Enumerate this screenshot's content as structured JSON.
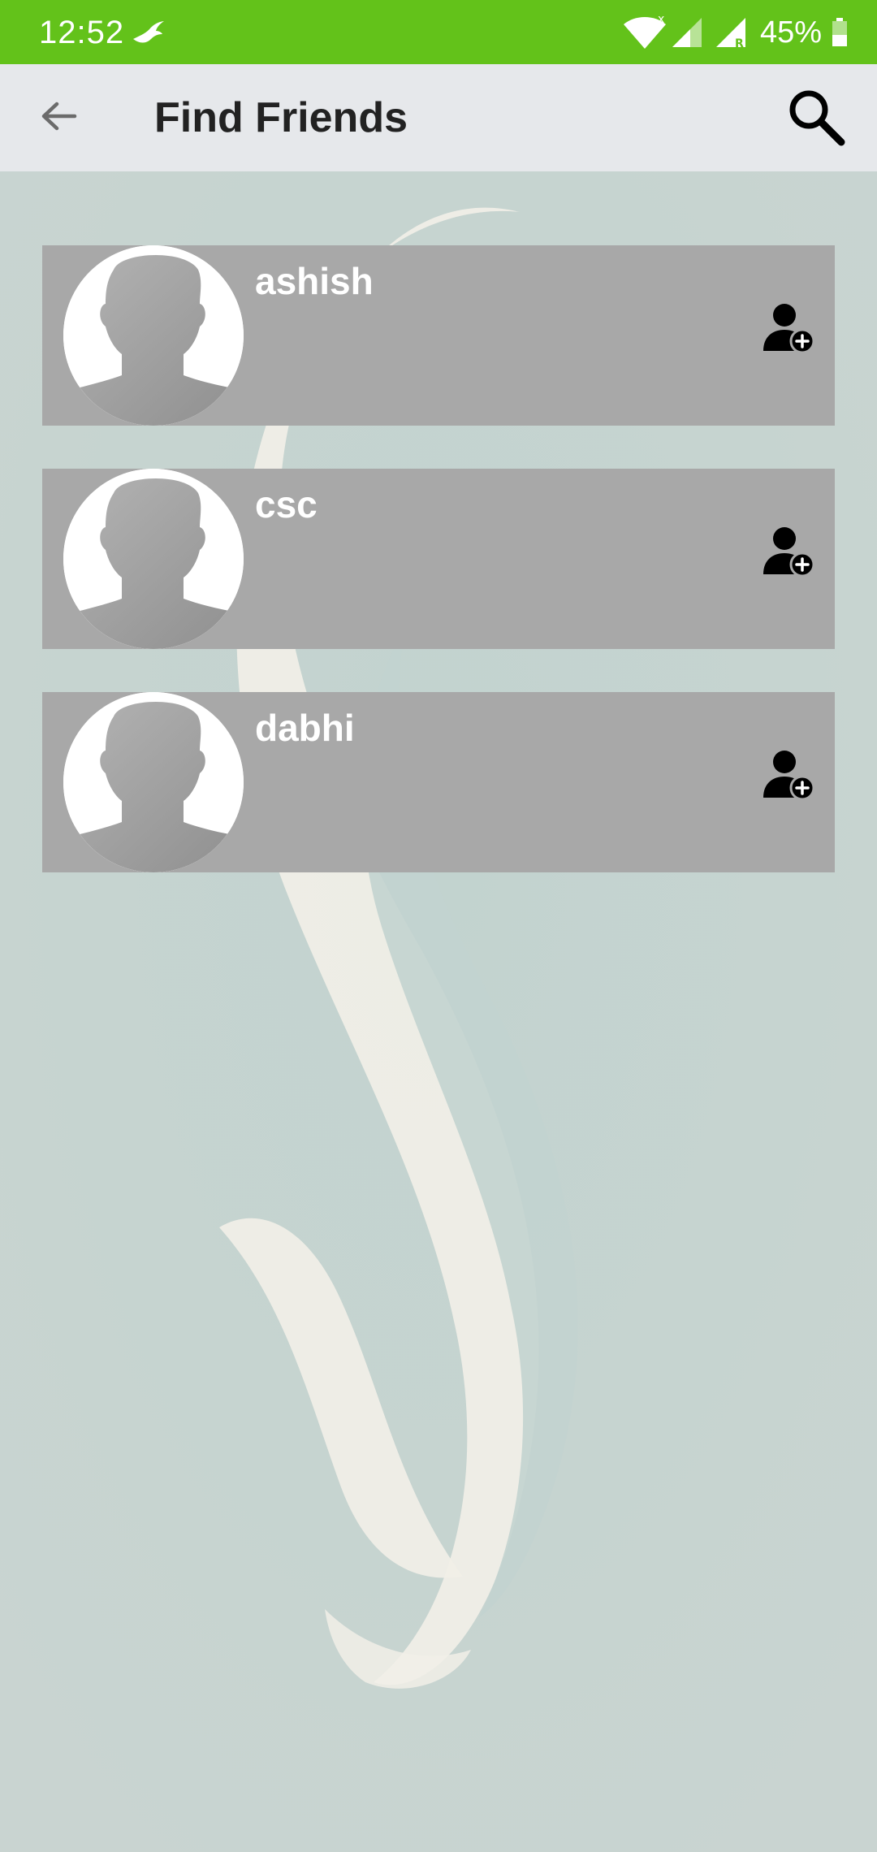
{
  "status_bar": {
    "time": "12:52",
    "app_icon": "bird-icon",
    "wifi_icon": "wifi-icon",
    "signal_icon": "cell-signal-icon",
    "roaming_signal_icon": "cell-signal-roaming-icon",
    "battery_percent": "45%",
    "battery_level": 0.45,
    "background_color": "#63c21a"
  },
  "app_bar": {
    "title": "Find Friends",
    "back_icon": "arrow-back-icon",
    "search_icon": "search-icon",
    "background_color": "#e6e8eb"
  },
  "friends": [
    {
      "name": "ashish",
      "avatar": "default-avatar-icon",
      "action_icon": "add-friend-icon"
    },
    {
      "name": "csc",
      "avatar": "default-avatar-icon",
      "action_icon": "add-friend-icon"
    },
    {
      "name": "dabhi",
      "avatar": "default-avatar-icon",
      "action_icon": "add-friend-icon"
    }
  ],
  "colors": {
    "card_background": "#a8a8a8",
    "screen_background": "#c6d3d0"
  }
}
